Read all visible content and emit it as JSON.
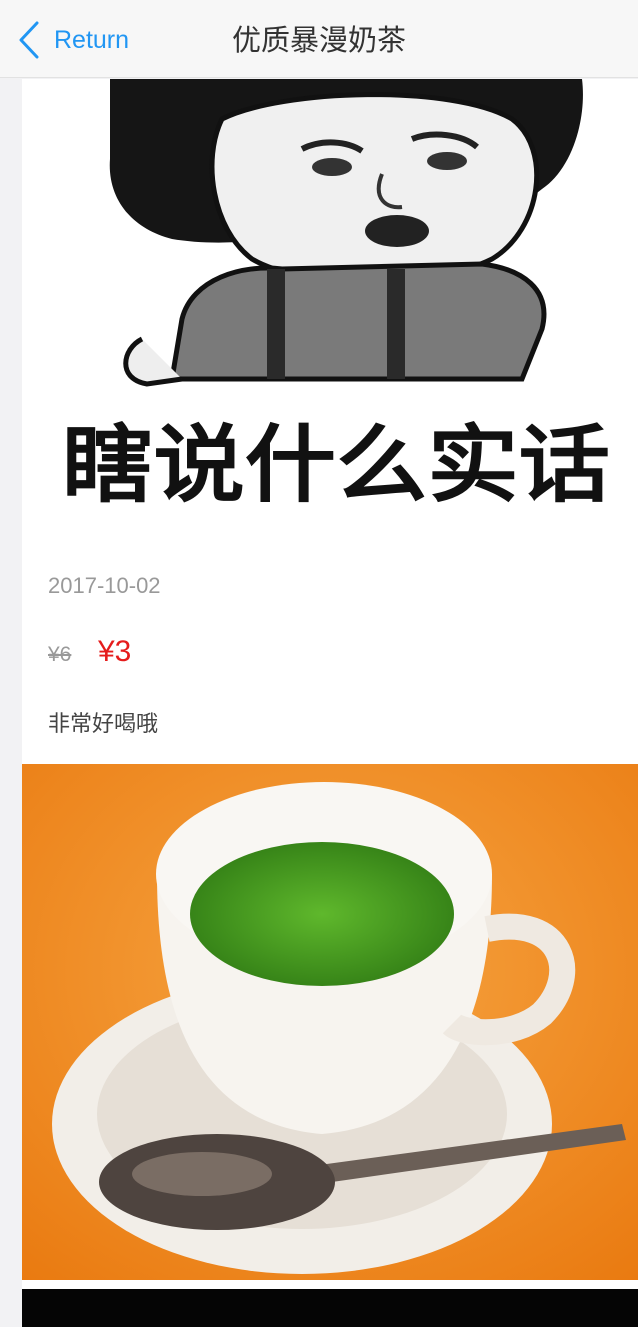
{
  "nav": {
    "back_label": "Return",
    "title": "优质暴漫奶茶"
  },
  "items": [
    {
      "image_caption": "瞎说什么实话",
      "date": "2017-10-02",
      "price_original": "¥6",
      "price_current": "¥3",
      "description": "非常好喝哦"
    }
  ],
  "colors": {
    "accent": "#2196f3",
    "price": "#e51c1c",
    "muted": "#999999"
  }
}
